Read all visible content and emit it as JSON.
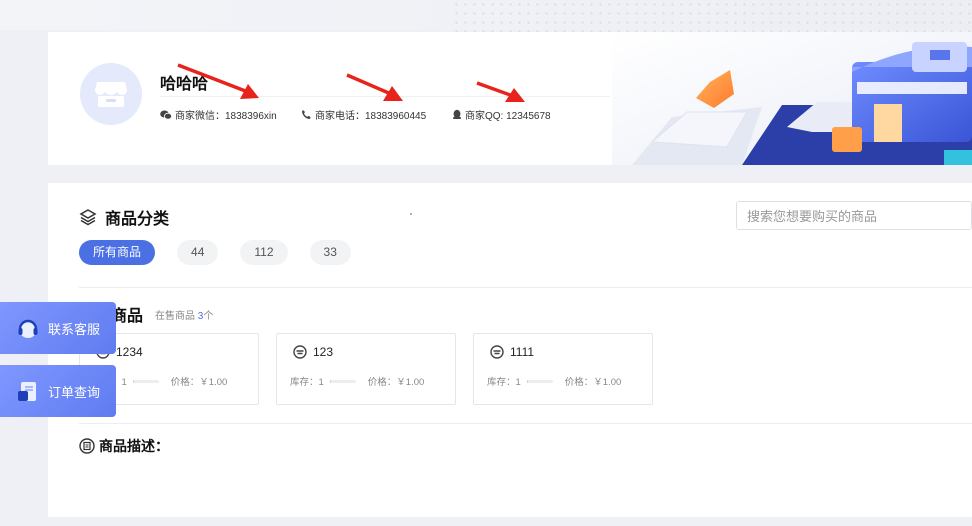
{
  "shop": {
    "name": "哈哈哈",
    "wechat": "商家微信：1838396xin",
    "phone": "商家电话：18383960445",
    "qq": "商家QQ: 12345678"
  },
  "categories": {
    "title": "商品分类",
    "search_placeholder": "搜索您想要购买的商品",
    "items": [
      {
        "label": "所有商品",
        "active": true
      },
      {
        "label": "44"
      },
      {
        "label": "112"
      },
      {
        "label": "33"
      }
    ]
  },
  "select": {
    "title": "选择商品",
    "subtitle_prefix": "在售商品",
    "count": "3",
    "subtitle_suffix": "个"
  },
  "products": [
    {
      "name": "1234",
      "stock_label": "库存：1",
      "price_label": "价格：￥1.00",
      "stock_fill": 0.04
    },
    {
      "name": "123",
      "stock_label": "库存：1",
      "price_label": "价格：￥1.00",
      "stock_fill": 0.04
    },
    {
      "name": "1111",
      "stock_label": "库存：1",
      "price_label": "价格：￥1.00",
      "stock_fill": 0.04
    }
  ],
  "description": {
    "title": "商品描述："
  },
  "floating": {
    "service": "联系客服",
    "orders": "订单查询"
  },
  "colors": {
    "accent": "#4a70e4",
    "arrow": "#e8231c"
  }
}
